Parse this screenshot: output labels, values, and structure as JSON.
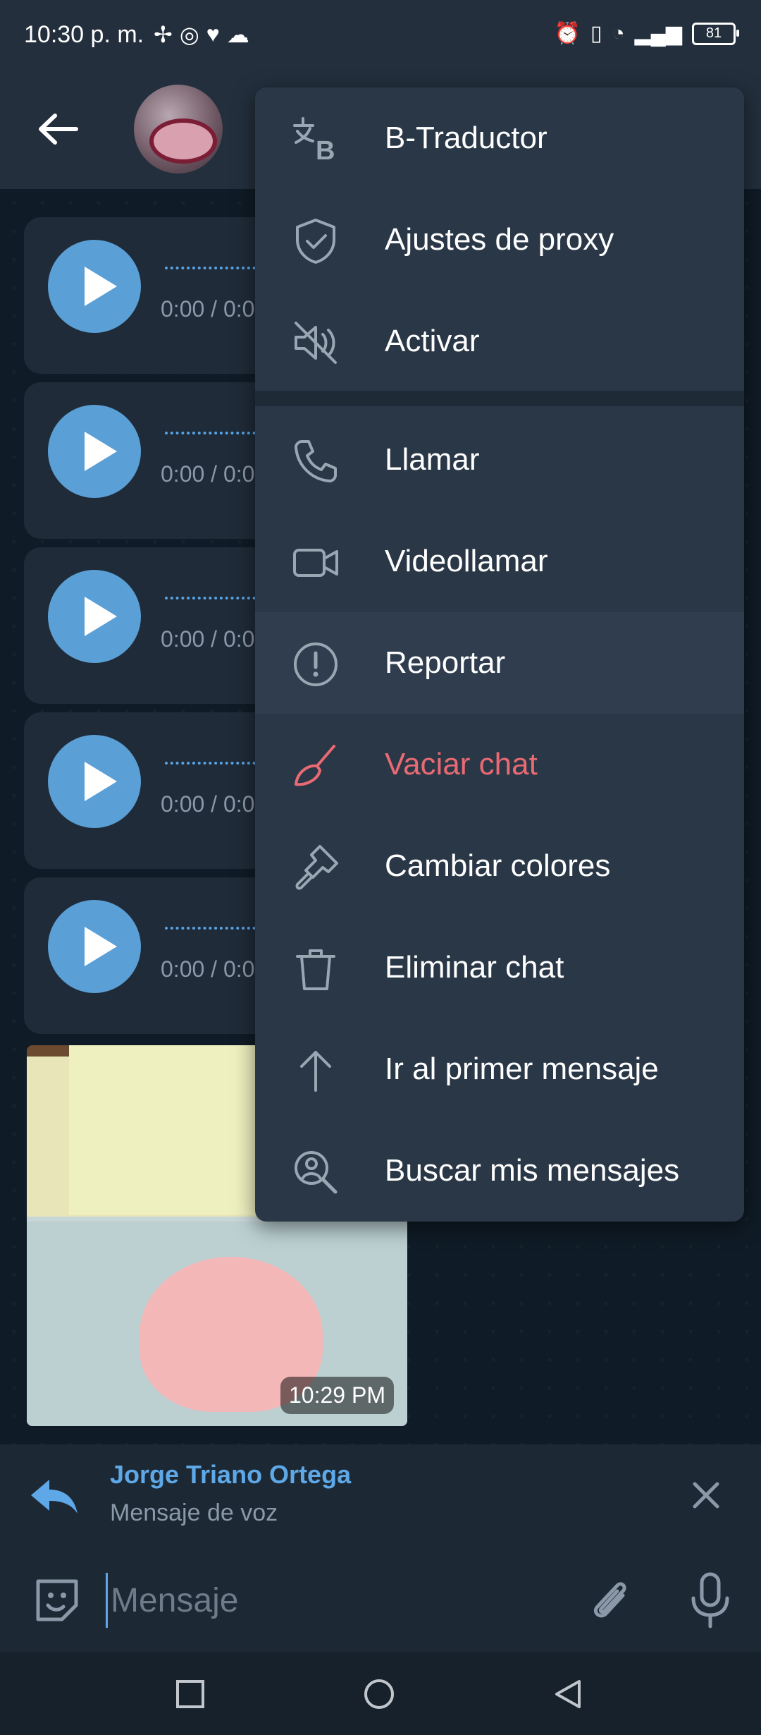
{
  "status_bar": {
    "time": "10:30 p. m.",
    "battery": "81"
  },
  "header": {
    "back_icon": "arrow-left-icon"
  },
  "voice_messages": [
    {
      "time": "0:00 / 0:0"
    },
    {
      "time": "0:00 / 0:0"
    },
    {
      "time": "0:00 / 0:0"
    },
    {
      "time": "0:00 / 0:0"
    },
    {
      "time": "0:00 / 0:0"
    }
  ],
  "photo_message": {
    "time": "10:29 PM"
  },
  "reply": {
    "name": "Jorge Triano Ortega",
    "text": "Mensaje de voz"
  },
  "input": {
    "placeholder": "Mensaje"
  },
  "menu": {
    "items": [
      {
        "label": "B-Traductor",
        "icon": "translate-icon"
      },
      {
        "label": "Ajustes de proxy",
        "icon": "shield-check-icon"
      },
      {
        "label": "Activar",
        "icon": "mute-icon"
      },
      {
        "label": "Llamar",
        "icon": "phone-icon"
      },
      {
        "label": "Videollamar",
        "icon": "video-icon"
      },
      {
        "label": "Reportar",
        "icon": "alert-circle-icon"
      },
      {
        "label": "Vaciar chat",
        "icon": "broom-icon"
      },
      {
        "label": "Cambiar colores",
        "icon": "paint-brush-icon"
      },
      {
        "label": "Eliminar chat",
        "icon": "trash-icon"
      },
      {
        "label": "Ir al primer mensaje",
        "icon": "arrow-up-icon"
      },
      {
        "label": "Buscar mis mensajes",
        "icon": "search-user-icon"
      }
    ]
  },
  "colors": {
    "accent": "#5ea8e8",
    "danger": "#e96a73",
    "menu_bg": "#2a3747",
    "play_button": "#5a9fd6"
  }
}
